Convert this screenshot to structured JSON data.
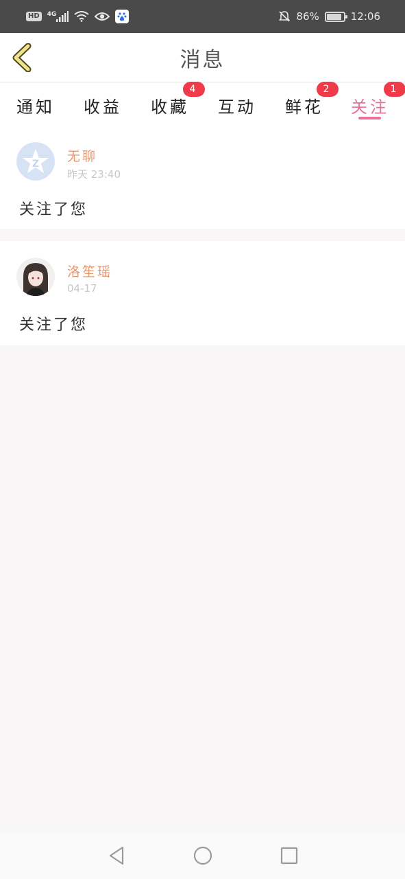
{
  "status_bar": {
    "hd": "HD",
    "network": "4G",
    "battery_percent": "86%",
    "battery_level": 0.86,
    "time": "12:06",
    "icons": [
      "signal-icon",
      "wifi-icon",
      "eye-icon",
      "baidu-app-icon",
      "bell-mute-icon",
      "battery-icon"
    ]
  },
  "header": {
    "title": "消息",
    "back_icon": "chevron-left-icon",
    "accent_color": "#f0e28a"
  },
  "tabs": [
    {
      "label": "通知",
      "badge": ""
    },
    {
      "label": "收益",
      "badge": ""
    },
    {
      "label": "收藏",
      "badge": "4"
    },
    {
      "label": "互动",
      "badge": ""
    },
    {
      "label": "鲜花",
      "badge": "2"
    },
    {
      "label": "关注",
      "badge": "1",
      "active": true
    }
  ],
  "theme": {
    "active_color": "#e8709a",
    "badge_color": "#ef3a4a",
    "name_color": "#e8966a"
  },
  "messages": [
    {
      "name": "无聊",
      "time": "昨天 23:40",
      "text": "关注了您",
      "avatar": "default-star-avatar"
    },
    {
      "name": "洛笙瑶",
      "time": "04-17",
      "text": "关注了您",
      "avatar": "girl-portrait-avatar"
    }
  ],
  "nav": {
    "icons": [
      "back-triangle-icon",
      "home-circle-icon",
      "recents-square-icon"
    ]
  }
}
